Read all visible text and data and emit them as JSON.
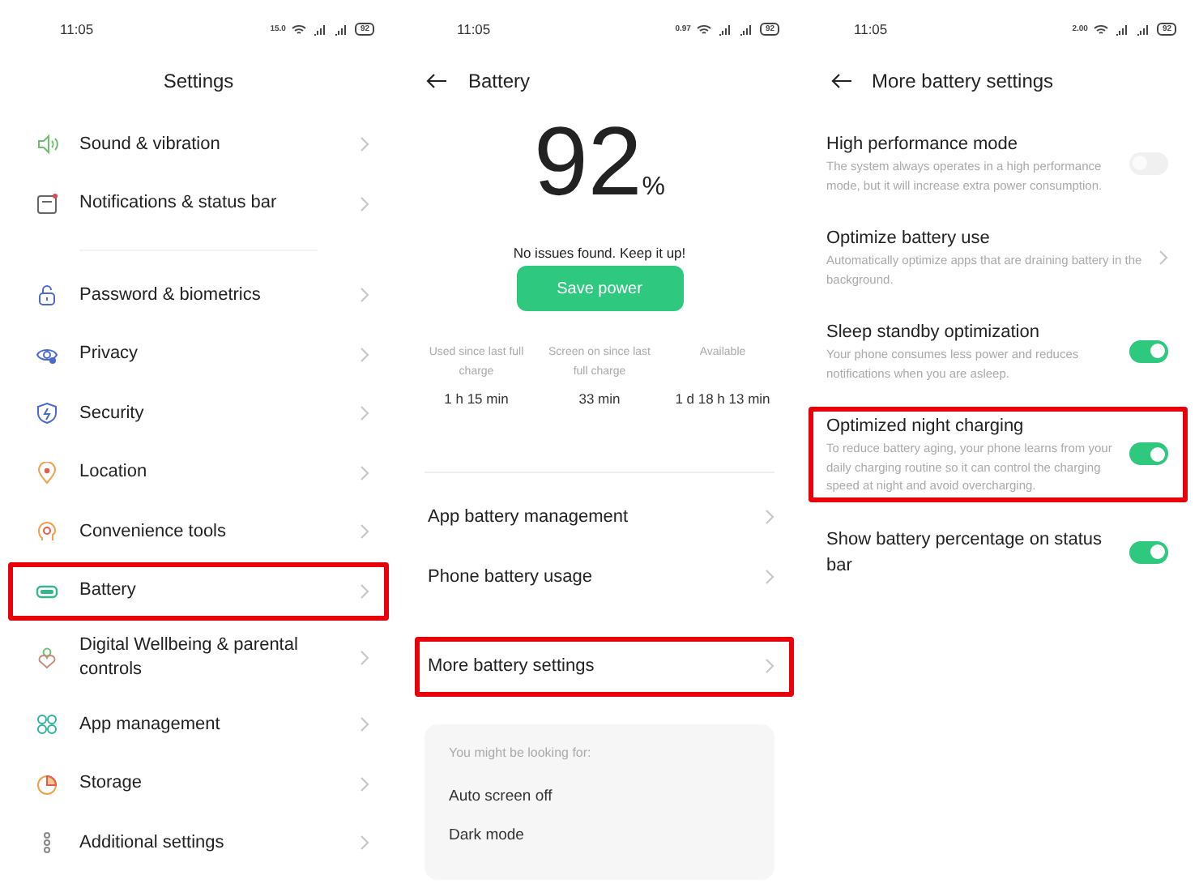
{
  "settings_screen": {
    "status_bar": {
      "time": "11:05",
      "speed": "15.0",
      "battery": "92"
    },
    "title": "Settings",
    "groups": [
      [
        {
          "label": "Sound & vibration",
          "highlighted": false
        },
        {
          "label": "Notifications & status bar",
          "highlighted": false
        }
      ],
      [
        {
          "label": "Password & biometrics",
          "highlighted": false
        },
        {
          "label": "Privacy",
          "highlighted": false
        },
        {
          "label": "Security",
          "highlighted": false
        },
        {
          "label": "Location",
          "highlighted": false
        },
        {
          "label": "Convenience tools",
          "highlighted": false
        },
        {
          "label": "Battery",
          "highlighted": true
        },
        {
          "label": "Digital Wellbeing & parental controls",
          "highlighted": false
        },
        {
          "label": "App management",
          "highlighted": false
        },
        {
          "label": "Storage",
          "highlighted": false
        },
        {
          "label": "Additional settings",
          "highlighted": false
        }
      ]
    ]
  },
  "battery_screen": {
    "status_bar": {
      "time": "11:05",
      "speed": "0.97",
      "battery": "92"
    },
    "title": "Battery",
    "percent": "92",
    "percent_sign": "%",
    "status_message": "No issues found. Keep it up!",
    "save_button": "Save power",
    "stats": [
      {
        "label": "Used since last full charge",
        "value": "1 h 15 min"
      },
      {
        "label": "Screen on since last full charge",
        "value": "33 min"
      },
      {
        "label": "Available",
        "value": "1 d 18 h 13 min"
      }
    ],
    "items": [
      {
        "label": "App battery management",
        "highlighted": false
      },
      {
        "label": "Phone battery usage",
        "highlighted": false
      },
      {
        "label": "More battery settings",
        "highlighted": true
      }
    ],
    "suggestions": {
      "heading": "You might be looking for:",
      "items": [
        "Auto screen off",
        "Dark mode"
      ]
    }
  },
  "more_settings_screen": {
    "status_bar": {
      "time": "11:05",
      "speed": "2.00",
      "battery": "92"
    },
    "title": "More battery settings",
    "items": [
      {
        "kind": "toggle",
        "title": "High performance mode",
        "description": "The system always operates in a high performance mode, but it will increase extra power consumption.",
        "on": false,
        "disabled": true,
        "highlighted": false
      },
      {
        "kind": "link",
        "title": "Optimize battery use",
        "description": "Automatically optimize apps that are draining battery in the background.",
        "highlighted": false
      },
      {
        "kind": "toggle",
        "title": "Sleep standby optimization",
        "description": "Your phone consumes less power and reduces notifications when you are asleep.",
        "on": true,
        "disabled": false,
        "highlighted": false
      },
      {
        "kind": "toggle",
        "title": "Optimized night charging",
        "description": "To reduce battery aging, your phone learns from your daily charging routine so it can control the charging speed at night and avoid overcharging.",
        "on": true,
        "disabled": false,
        "highlighted": true
      },
      {
        "kind": "toggle",
        "title": "Show battery percentage on status bar",
        "on": true,
        "disabled": false,
        "highlighted": false
      }
    ]
  }
}
